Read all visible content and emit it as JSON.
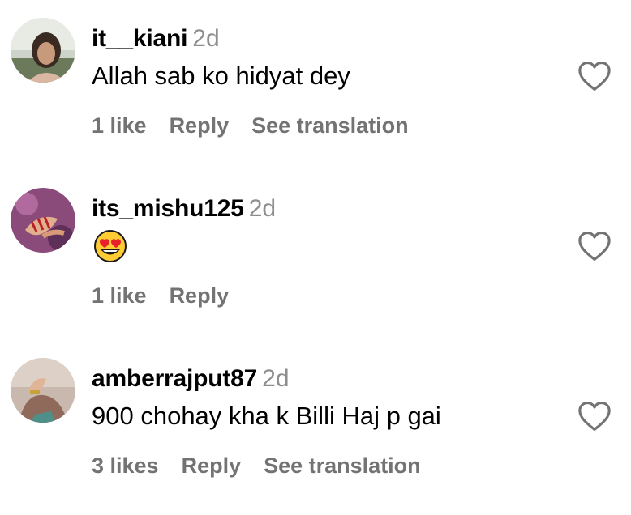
{
  "comments": [
    {
      "username": "it__kiani",
      "time": "2d",
      "text": "Allah sab ko hidyat dey",
      "likes": "1 like",
      "reply": "Reply",
      "translate": "See translation",
      "avatar_icon": "profile-photo-icon",
      "like_icon": "heart-outline-icon"
    },
    {
      "username": "its_mishu125",
      "time": "2d",
      "text_emoji": "heart-eyes-emoji",
      "likes": "1 like",
      "reply": "Reply",
      "avatar_icon": "profile-photo-icon",
      "like_icon": "heart-outline-icon"
    },
    {
      "username": "amberrajput87",
      "time": "2d",
      "text": "900 chohay kha k Billi Haj p gai",
      "likes": "3 likes",
      "reply": "Reply",
      "translate": "See translation",
      "avatar_icon": "profile-photo-icon",
      "like_icon": "heart-outline-icon"
    }
  ],
  "colors": {
    "username": "#000000",
    "secondary_text": "#8e8e8e",
    "action_text": "#737373",
    "heart_stroke": "#737373"
  }
}
